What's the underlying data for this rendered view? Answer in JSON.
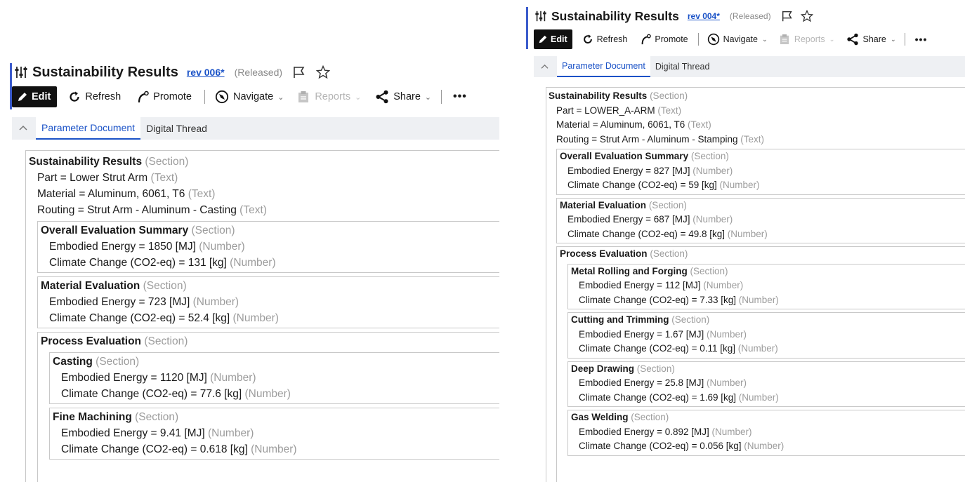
{
  "left": {
    "header": {
      "title": "Sustainability Results",
      "revision": "rev 006*",
      "status": "(Released)"
    },
    "toolbar": {
      "edit": "Edit",
      "refresh": "Refresh",
      "promote": "Promote",
      "navigate": "Navigate",
      "reports": "Reports",
      "share": "Share",
      "more": "•••"
    },
    "tabs": {
      "active": "Parameter Document",
      "inactive": "Digital Thread"
    },
    "document": {
      "section": {
        "name": "Sustainability Results",
        "type": "(Section)"
      },
      "fields": [
        {
          "text": "Part = Lower Strut Arm",
          "type": "(Text)"
        },
        {
          "text": "Material = Aluminum, 6061, T6",
          "type": "(Text)"
        },
        {
          "text": "Routing = Strut Arm - Aluminum - Casting",
          "type": "(Text)"
        }
      ],
      "overall": {
        "name": "Overall Evaluation Summary",
        "type": "(Section)",
        "energy": "Embodied Energy = 1850 [MJ]",
        "energy_type": "(Number)",
        "climate": "Climate Change (CO2-eq) = 131 [kg]",
        "climate_type": "(Number)"
      },
      "material": {
        "name": "Material Evaluation",
        "type": "(Section)",
        "energy": "Embodied Energy = 723 [MJ]",
        "energy_type": "(Number)",
        "climate": "Climate Change (CO2-eq) = 52.4 [kg]",
        "climate_type": "(Number)"
      },
      "process": {
        "name": "Process Evaluation",
        "type": "(Section)",
        "sub": [
          {
            "name": "Casting",
            "type": "(Section)",
            "energy": "Embodied Energy = 1120 [MJ]",
            "energy_type": "(Number)",
            "climate": "Climate Change (CO2-eq) = 77.6 [kg]",
            "climate_type": "(Number)"
          },
          {
            "name": "Fine Machining",
            "type": "(Section)",
            "energy": "Embodied Energy = 9.41 [MJ]",
            "energy_type": "(Number)",
            "climate": "Climate Change (CO2-eq) = 0.618 [kg]",
            "climate_type": "(Number)"
          }
        ]
      }
    }
  },
  "right": {
    "header": {
      "title": "Sustainability Results",
      "revision": "rev 004*",
      "status": "(Released)"
    },
    "toolbar": {
      "edit": "Edit",
      "refresh": "Refresh",
      "promote": "Promote",
      "navigate": "Navigate",
      "reports": "Reports",
      "share": "Share",
      "more": "•••"
    },
    "tabs": {
      "active": "Parameter Document",
      "inactive": "Digital Thread"
    },
    "document": {
      "section": {
        "name": "Sustainability Results",
        "type": "(Section)"
      },
      "fields": [
        {
          "text": "Part = LOWER_A-ARM",
          "type": "(Text)"
        },
        {
          "text": "Material = Aluminum, 6061, T6",
          "type": "(Text)"
        },
        {
          "text": "Routing = Strut Arm - Aluminum - Stamping",
          "type": "(Text)"
        }
      ],
      "overall": {
        "name": "Overall Evaluation Summary",
        "type": "(Section)",
        "energy": "Embodied Energy = 827 [MJ]",
        "energy_type": "(Number)",
        "climate": "Climate Change (CO2-eq) = 59 [kg]",
        "climate_type": "(Number)"
      },
      "material": {
        "name": "Material Evaluation",
        "type": "(Section)",
        "energy": "Embodied Energy = 687 [MJ]",
        "energy_type": "(Number)",
        "climate": "Climate Change (CO2-eq) = 49.8 [kg]",
        "climate_type": "(Number)"
      },
      "process": {
        "name": "Process Evaluation",
        "type": "(Section)",
        "sub": [
          {
            "name": "Metal Rolling and Forging",
            "type": "(Section)",
            "energy": "Embodied Energy = 112 [MJ]",
            "energy_type": "(Number)",
            "climate": "Climate Change (CO2-eq) = 7.33 [kg]",
            "climate_type": "(Number)"
          },
          {
            "name": "Cutting and Trimming",
            "type": "(Section)",
            "energy": "Embodied Energy = 1.67 [MJ]",
            "energy_type": "(Number)",
            "climate": "Climate Change (CO2-eq) = 0.11 [kg]",
            "climate_type": "(Number)"
          },
          {
            "name": "Deep Drawing",
            "type": "(Section)",
            "energy": "Embodied Energy = 25.8 [MJ]",
            "energy_type": "(Number)",
            "climate": "Climate Change (CO2-eq) = 1.69 [kg]",
            "climate_type": "(Number)"
          },
          {
            "name": "Gas Welding",
            "type": "(Section)",
            "energy": "Embodied Energy = 0.892 [MJ]",
            "energy_type": "(Number)",
            "climate": "Climate Change (CO2-eq) = 0.056 [kg]",
            "climate_type": "(Number)"
          }
        ]
      }
    }
  }
}
